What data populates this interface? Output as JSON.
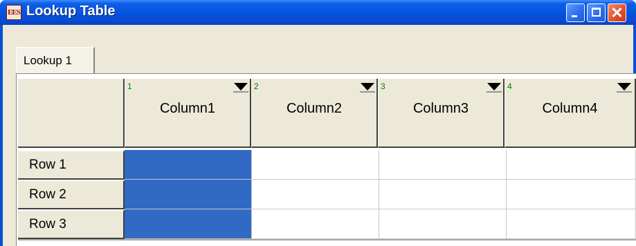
{
  "window": {
    "title": "Lookup Table",
    "icon_label": "EES",
    "controls": [
      "minimize-icon",
      "maximize-icon",
      "close-icon"
    ],
    "close_glyph": "✕"
  },
  "tabs": [
    {
      "label": "Lookup 1",
      "active": true
    }
  ],
  "table": {
    "columns": [
      {
        "number": "1",
        "name": "Column1"
      },
      {
        "number": "2",
        "name": "Column2"
      },
      {
        "number": "3",
        "name": "Column3"
      },
      {
        "number": "4",
        "name": "Column4"
      }
    ],
    "rows": [
      "Row 1",
      "Row 2",
      "Row 3"
    ],
    "selected_column": 1
  },
  "colors": {
    "title_bar": "#0552dc",
    "selection": "#316ac5",
    "column_number": "#008000",
    "face": "#ece9d8"
  }
}
